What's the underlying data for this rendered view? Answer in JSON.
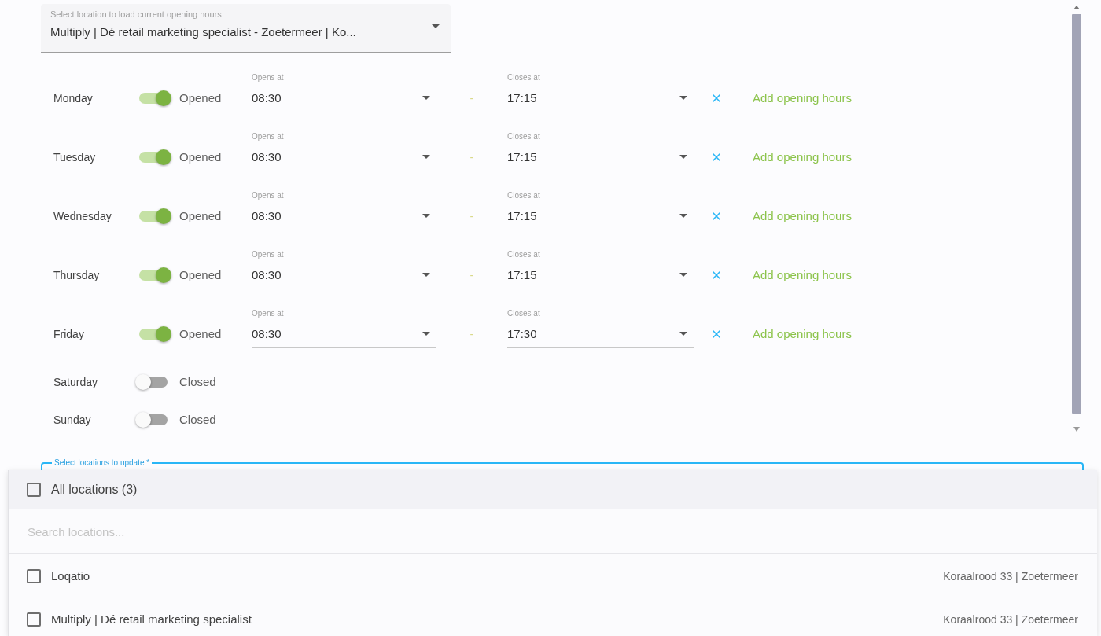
{
  "location_select": {
    "label": "Select location to load current opening hours",
    "value": "Multiply | Dé retail marketing specialist - Zoetermeer | Ko..."
  },
  "days": [
    {
      "name": "Monday",
      "open": true,
      "status": "Opened",
      "opens_label": "Opens at",
      "opens": "08:30",
      "separator": "-",
      "closes_label": "Closes at",
      "closes": "17:15",
      "add_label": "Add opening hours"
    },
    {
      "name": "Tuesday",
      "open": true,
      "status": "Opened",
      "opens_label": "Opens at",
      "opens": "08:30",
      "separator": "-",
      "closes_label": "Closes at",
      "closes": "17:15",
      "add_label": "Add opening hours"
    },
    {
      "name": "Wednesday",
      "open": true,
      "status": "Opened",
      "opens_label": "Opens at",
      "opens": "08:30",
      "separator": "-",
      "closes_label": "Closes at",
      "closes": "17:15",
      "add_label": "Add opening hours"
    },
    {
      "name": "Thursday",
      "open": true,
      "status": "Opened",
      "opens_label": "Opens at",
      "opens": "08:30",
      "separator": "-",
      "closes_label": "Closes at",
      "closes": "17:15",
      "add_label": "Add opening hours"
    },
    {
      "name": "Friday",
      "open": true,
      "status": "Opened",
      "opens_label": "Opens at",
      "opens": "08:30",
      "separator": "-",
      "closes_label": "Closes at",
      "closes": "17:30",
      "add_label": "Add opening hours"
    },
    {
      "name": "Saturday",
      "open": false,
      "status": "Closed"
    },
    {
      "name": "Sunday",
      "open": false,
      "status": "Closed"
    }
  ],
  "locations_select": {
    "label": "Select locations to update *",
    "focused": true
  },
  "locations_menu": {
    "all": {
      "label": "All locations (3)",
      "checked": false
    },
    "search": {
      "placeholder": "Search locations..."
    },
    "items": [
      {
        "name": "Loqatio",
        "address": "Koraalrood 33 | Zoetermeer",
        "checked": false
      },
      {
        "name": "Multiply | Dé retail marketing specialist",
        "address": "Koraalrood 33 | Zoetermeer",
        "checked": false
      }
    ]
  }
}
